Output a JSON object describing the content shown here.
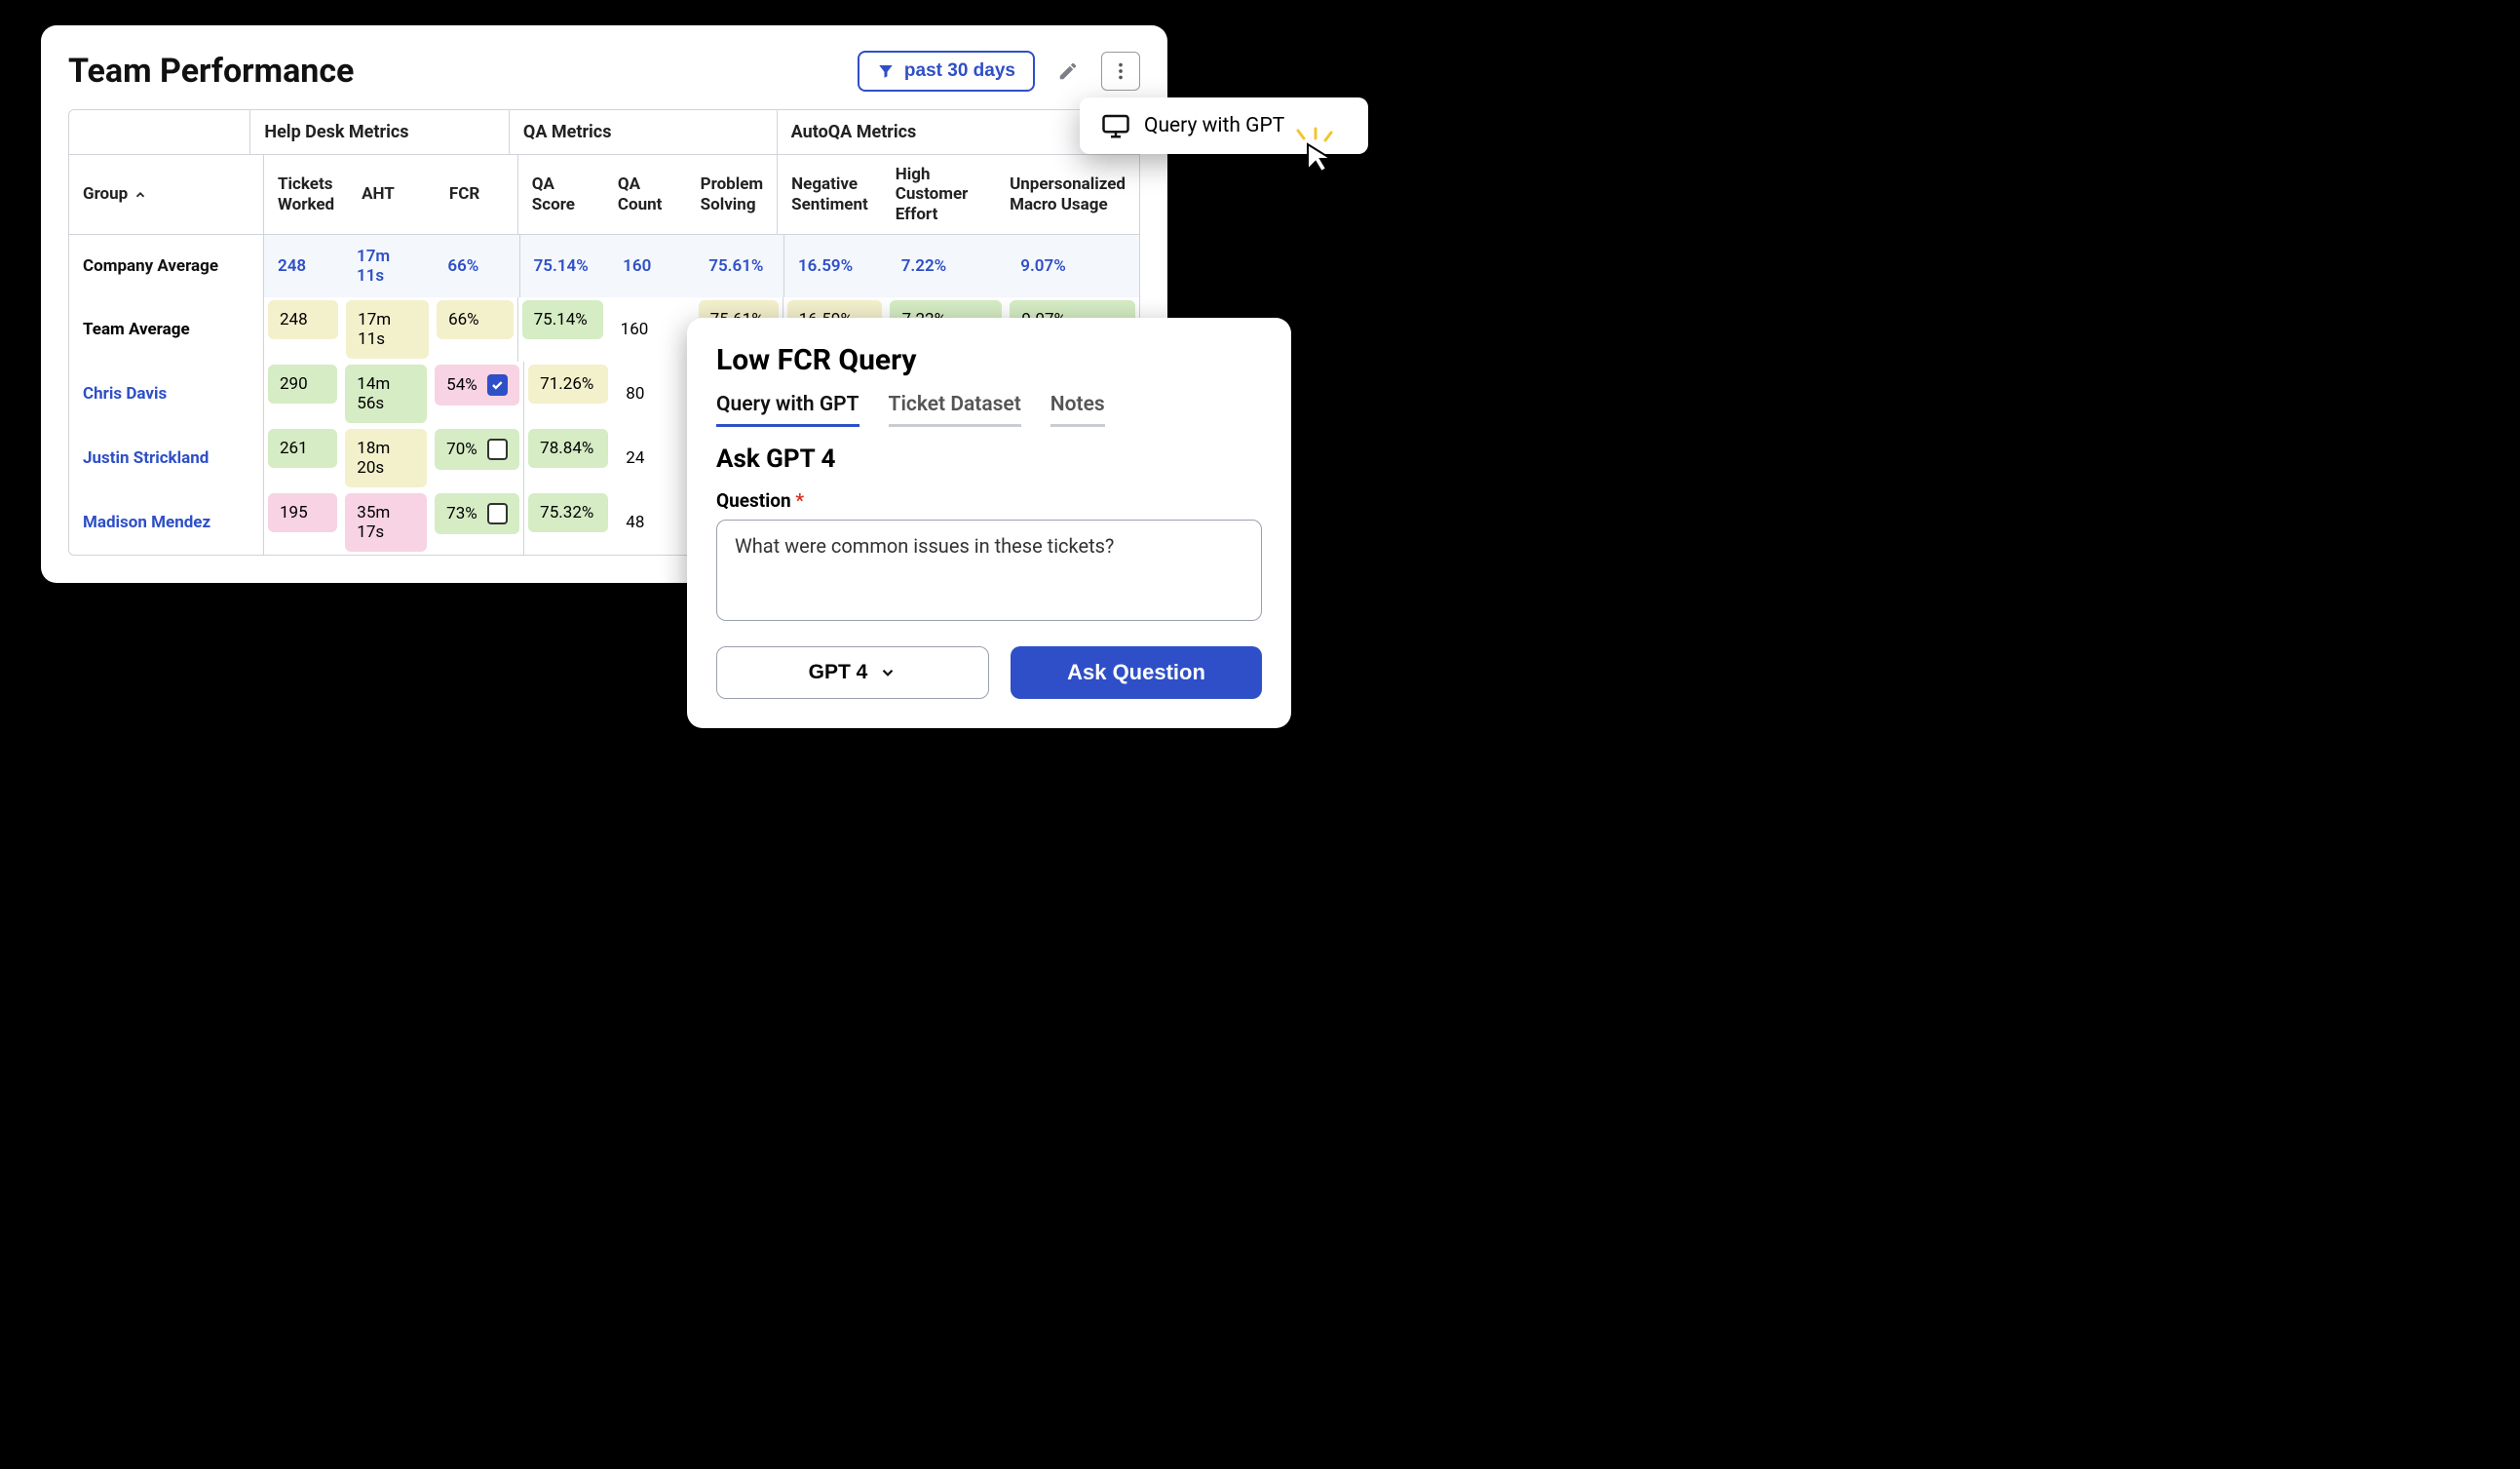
{
  "main": {
    "title": "Team Performance",
    "filter_label": "past 30 days"
  },
  "menu": {
    "query_gpt": "Query with GPT"
  },
  "table": {
    "group_headers": {
      "help_desk": "Help Desk Metrics",
      "qa": "QA Metrics",
      "autoqa": "AutoQA Metrics"
    },
    "columns": {
      "group": "Group",
      "tickets_worked": "Tickets Worked",
      "aht": "AHT",
      "fcr": "FCR",
      "qa_score": "QA Score",
      "qa_count": "QA Count",
      "problem_solving": "Problem Solving",
      "negative_sentiment": "Negative Sentiment",
      "high_customer_effort": "High Customer Effort",
      "unpersonalized_macro": "Unpersonalized Macro Usage"
    },
    "rows": {
      "company": {
        "name": "Company Average",
        "tw": "248",
        "aht": "17m 11s",
        "fcr": "66%",
        "qas": "75.14%",
        "qac": "160",
        "ps": "75.61%",
        "ns": "16.59%",
        "hce": "7.22%",
        "umu": "9.07%"
      },
      "team": {
        "name": "Team Average",
        "tw": "248",
        "aht": "17m 11s",
        "fcr": "66%",
        "qas": "75.14%",
        "qac": "160",
        "ps": "75.61%",
        "ns": "16.59%",
        "hce": "7.22%",
        "umu": "9.07%"
      },
      "r1": {
        "name": "Chris Davis",
        "tw": "290",
        "aht": "14m 56s",
        "fcr": "54%",
        "qas": "71.26%",
        "qac": "80"
      },
      "r2": {
        "name": "Justin Strickland",
        "tw": "261",
        "aht": "18m 20s",
        "fcr": "70%",
        "qas": "78.84%",
        "qac": "24"
      },
      "r3": {
        "name": "Madison Mendez",
        "tw": "195",
        "aht": "35m 17s",
        "fcr": "73%",
        "qas": "75.32%",
        "qac": "48"
      }
    }
  },
  "query": {
    "title": "Low FCR Query",
    "tabs": {
      "gpt": "Query with GPT",
      "dataset": "Ticket Dataset",
      "notes": "Notes"
    },
    "ask_title": "Ask GPT 4",
    "question_label": "Question",
    "question_value": "What were common issues in these tickets?",
    "model": "GPT 4",
    "ask_button": "Ask Question"
  }
}
